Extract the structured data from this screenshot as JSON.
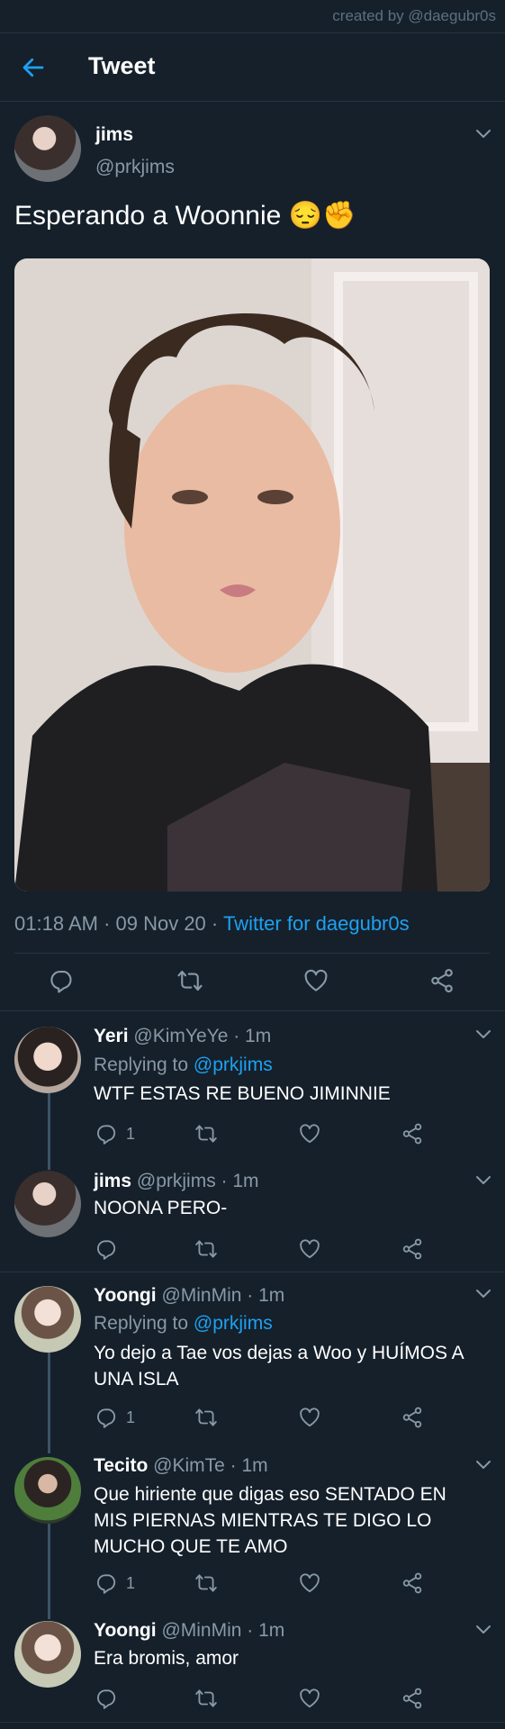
{
  "credit": "created by @daegubr0s",
  "header": {
    "title": "Tweet"
  },
  "tweet": {
    "name": "jims",
    "handle": "@prkjims",
    "text": "Esperando a Woonnie 😔✊",
    "time": "01:18 AM · 09 Nov 20 · ",
    "source": "Twitter for daegubr0s"
  },
  "replies": [
    {
      "name": "Yeri",
      "handle": "@KimYeYe · 1m",
      "replying_label": "Replying to ",
      "replying_to": "@prkjims",
      "text": [
        "WTF ESTAS RE BUENO JIMINNIE"
      ],
      "reply_count": "1"
    },
    {
      "name": "jims",
      "handle": "@prkjims · 1m",
      "text": [
        "NOONA PERO-"
      ],
      "reply_count": ""
    },
    {
      "name": "Yoongi",
      "handle": "@MinMin · 1m",
      "replying_label": "Replying to ",
      "replying_to": "@prkjims",
      "text": [
        "Yo dejo a Tae vos dejas a Woo y HUÍMOS A",
        "UNA ISLA"
      ],
      "reply_count": "1"
    },
    {
      "name": "Tecito",
      "handle": "@KimTe · 1m",
      "text": [
        "Que hiriente que digas eso SENTADO EN",
        "MIS PIERNAS MIENTRAS TE DIGO LO",
        "MUCHO QUE TE AMO"
      ],
      "reply_count": "1"
    },
    {
      "name": "Yoongi",
      "handle": "@MinMin · 1m",
      "text": [
        "Era bromis, amor"
      ],
      "reply_count": ""
    }
  ],
  "colors": {
    "background": "#15202b",
    "accent": "#1da1f2",
    "muted": "#8899a6",
    "divider": "#26343f"
  },
  "icons": [
    "back-arrow-icon",
    "chevron-down-icon",
    "reply-icon",
    "retweet-icon",
    "like-icon",
    "share-icon"
  ]
}
